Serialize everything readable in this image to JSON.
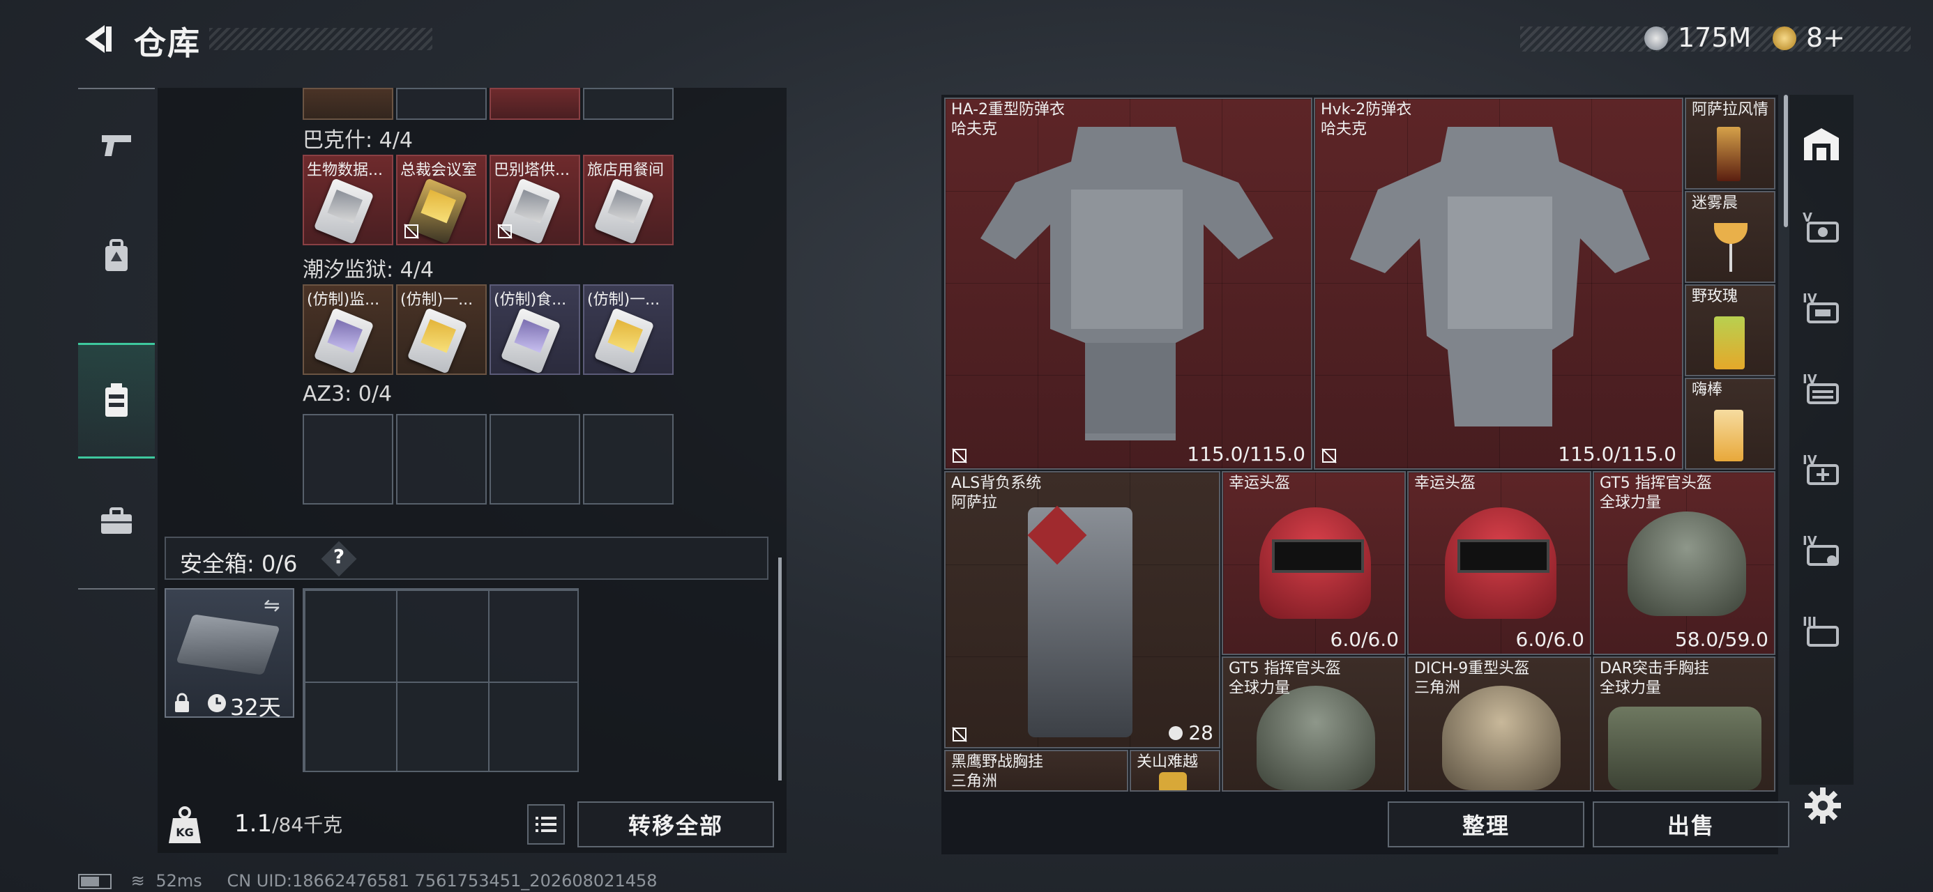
{
  "header": {
    "title": "仓库",
    "back_icon": "back-arrow-icon"
  },
  "currency": [
    {
      "icon": "silver-coin-icon",
      "value": "175M"
    },
    {
      "icon": "gold-coin-icon",
      "value": "8+"
    }
  ],
  "left_nav": [
    {
      "icon": "pistol-icon",
      "active": false
    },
    {
      "icon": "backpack-icon",
      "active": false
    },
    {
      "icon": "container-icon",
      "active": true
    },
    {
      "icon": "briefcase-icon",
      "active": false
    }
  ],
  "storage": {
    "sections": [
      {
        "label": "巴克什: 4/4",
        "slots": [
          {
            "name": "生物数据...",
            "color": "red",
            "card": "white"
          },
          {
            "name": "总裁会议室",
            "color": "red",
            "card": "gold",
            "locked": true
          },
          {
            "name": "巴别塔供...",
            "color": "red",
            "card": "white",
            "locked": true
          },
          {
            "name": "旅店用餐间",
            "color": "red",
            "card": "white"
          }
        ]
      },
      {
        "label": "潮汐监狱: 4/4",
        "slots": [
          {
            "name": "(仿制)监...",
            "color": "brown",
            "card": "white"
          },
          {
            "name": "(仿制)一...",
            "color": "brown",
            "card": "yellow"
          },
          {
            "name": "(仿制)食...",
            "color": "purple",
            "card": "purple"
          },
          {
            "name": "(仿制)一...",
            "color": "purple",
            "card": "yellow"
          }
        ]
      },
      {
        "label": "AZ3: 0/4",
        "slots": []
      }
    ],
    "safe_box": {
      "label": "安全箱: 0/6",
      "help": "?",
      "days": "32天"
    },
    "weight": {
      "current": "1.1",
      "max": "/84千克"
    },
    "transfer_all": "转移全部"
  },
  "items": [
    {
      "name": "HA-2重型防弹衣",
      "brand": "哈夫克",
      "durability": "115.0/115.0",
      "color": "red"
    },
    {
      "name": "Hvk-2防弹衣",
      "brand": "哈夫克",
      "durability": "115.0/115.0",
      "color": "red"
    },
    {
      "name": "阿萨拉风情",
      "color": "brown"
    },
    {
      "name": "迷雾晨",
      "color": "brown"
    },
    {
      "name": "野玫瑰",
      "color": "brown"
    },
    {
      "name": "嗨棒",
      "color": "brown"
    },
    {
      "name": "ALS背负系统",
      "brand": "阿萨拉",
      "count": "28",
      "color": "brown"
    },
    {
      "name": "幸运头盔",
      "durability": "6.0/6.0",
      "color": "red"
    },
    {
      "name": "幸运头盔",
      "durability": "6.0/6.0",
      "color": "red"
    },
    {
      "name": "GT5 指挥官头盔",
      "brand": "全球力量",
      "durability": "58.0/59.0",
      "color": "red"
    },
    {
      "name": "GT5 指挥官头盔",
      "brand": "全球力量",
      "color": "brown"
    },
    {
      "name": "DICH-9重型头盔",
      "brand": "三角洲",
      "color": "brown"
    },
    {
      "name": "DAR突击手胸挂",
      "brand": "全球力量",
      "color": "brown"
    },
    {
      "name": "黑鹰野战胸挂",
      "brand": "三角洲",
      "color": "brown"
    },
    {
      "name": "关山难越",
      "color": "brown"
    }
  ],
  "actions": {
    "sort": "整理",
    "sell": "出售"
  },
  "right_nav": [
    "home-storage-icon",
    "tier-5-icon",
    "tier-4-icon",
    "tier-4-stack-icon",
    "tier-4-add-icon",
    "tier-4-ticket-icon",
    "tier-3-icon"
  ],
  "status": {
    "ping": "52ms",
    "uid": "CN UID:18662476581 7561753451_202608021458"
  }
}
